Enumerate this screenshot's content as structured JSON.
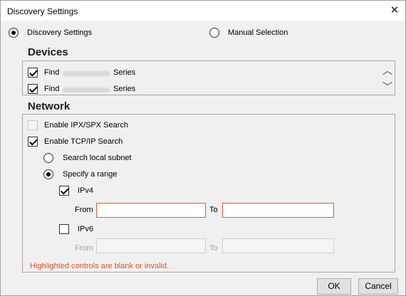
{
  "window": {
    "title": "Discovery Settings"
  },
  "mode": {
    "discovery_label": "Discovery Settings",
    "manual_label": "Manual Selection",
    "selected": "discovery"
  },
  "devices": {
    "title": "Devices",
    "items": [
      {
        "prefix": "Find",
        "suffix": "Series",
        "checked": true
      },
      {
        "prefix": "Find",
        "suffix": "Series",
        "checked": true
      }
    ]
  },
  "network": {
    "title": "Network",
    "ipx_label": "Enable IPX/SPX Search",
    "tcpip_label": "Enable TCP/IP Search",
    "local_subnet_label": "Search local subnet",
    "range_label": "Specify a range",
    "ipv4": {
      "label": "IPv4",
      "from_label": "From",
      "to_label": "To",
      "from_value": "",
      "to_value": ""
    },
    "ipv6": {
      "label": "IPv6",
      "from_label": "From",
      "to_label": "To",
      "from_value": "",
      "to_value": ""
    },
    "error_text": "Highlighted controls are blank or invalid."
  },
  "footer": {
    "ok_label": "OK",
    "cancel_label": "Cancel"
  },
  "colors": {
    "error": "#e0502a",
    "field_error_border": "#e05a3a"
  },
  "icons": {
    "close": "close-icon",
    "scroll_up": "chevron-up-icon",
    "scroll_down": "chevron-down-icon"
  }
}
